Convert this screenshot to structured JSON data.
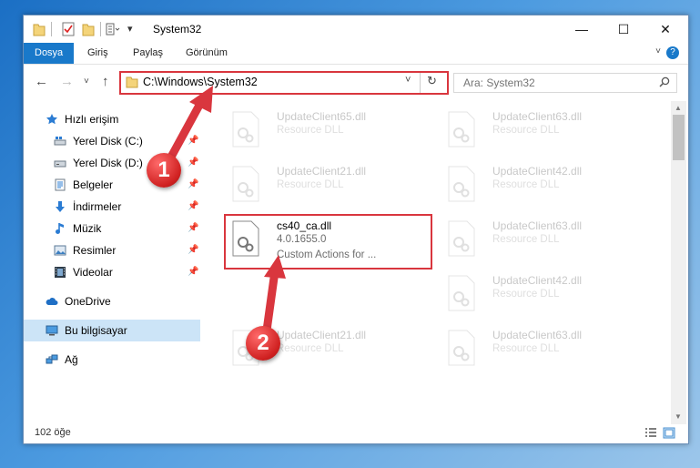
{
  "window": {
    "title": "System32",
    "controls": {
      "minimize": "—",
      "maximize": "☐",
      "close": "✕"
    }
  },
  "ribbon": {
    "tabs": [
      "Dosya",
      "Giriş",
      "Paylaş",
      "Görünüm"
    ],
    "help": "?"
  },
  "address": {
    "path": "C:\\Windows\\System32"
  },
  "search": {
    "placeholder": "Ara: System32"
  },
  "sidebar": {
    "quick_access": "Hızlı erişim",
    "items": [
      {
        "label": "Yerel Disk (C:)"
      },
      {
        "label": "Yerel Disk (D:)"
      },
      {
        "label": "Belgeler"
      },
      {
        "label": "İndirmeler"
      },
      {
        "label": "Müzik"
      },
      {
        "label": "Resimler"
      },
      {
        "label": "Videolar"
      }
    ],
    "onedrive": "OneDrive",
    "this_pc": "Bu bilgisayar",
    "network": "Ağ"
  },
  "files": [
    {
      "name": "UpdateClient65.dll",
      "desc": "Resource DLL"
    },
    {
      "name": "UpdateClient63.dll",
      "desc": "Resource DLL"
    },
    {
      "name": "UpdateClient21.dll",
      "desc": "Resource DLL"
    },
    {
      "name": "UpdateClient42.dll",
      "desc": "Resource DLL"
    },
    {
      "name": "cs40_ca.dll",
      "desc": "4.0.1655.0",
      "desc2": "Custom Actions for ..."
    },
    {
      "name": "UpdateClient63.dll",
      "desc": "Resource DLL"
    },
    {
      "name": "UpdateClient42.dll",
      "desc": "Resource DLL"
    },
    {
      "name": "UpdateClient21.dll",
      "desc": "Resource DLL"
    },
    {
      "name": "UpdateClient63.dll",
      "desc": "Resource DLL"
    }
  ],
  "status": {
    "count": "102 öğe"
  },
  "callouts": {
    "one": "1",
    "two": "2"
  },
  "colors": {
    "accent": "#1979ca",
    "highlight": "#d9363e",
    "selection": "#cce4f7"
  }
}
